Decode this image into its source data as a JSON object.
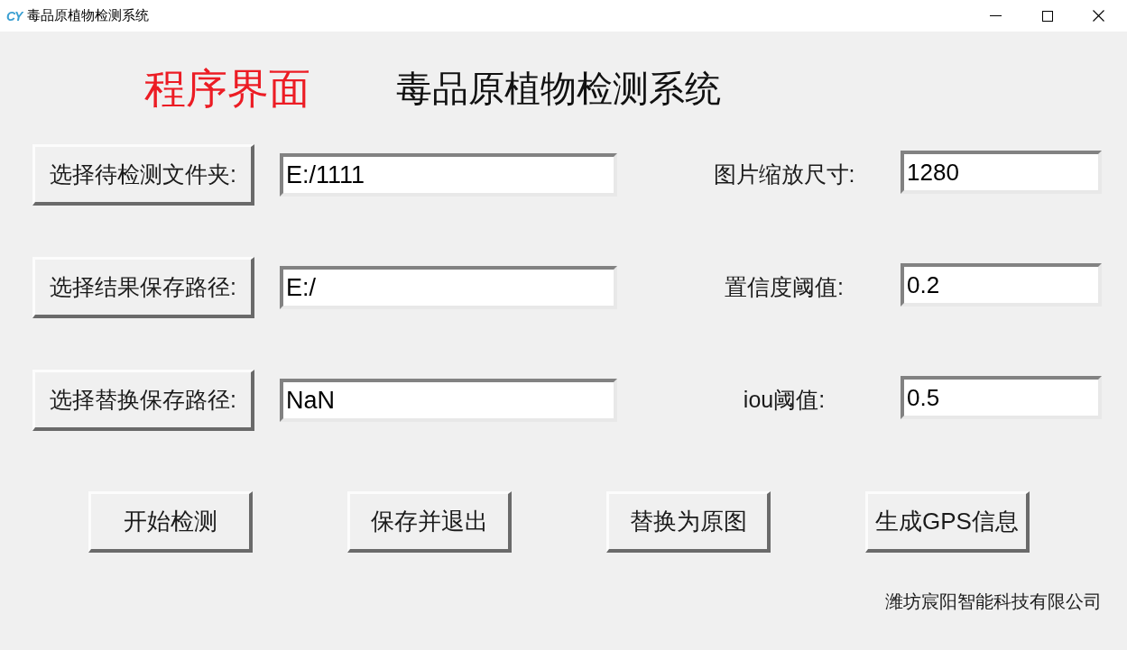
{
  "window": {
    "logo": "CY",
    "title": "毒品原植物检测系统"
  },
  "header": {
    "label": "程序界面",
    "title": "毒品原植物检测系统"
  },
  "rows": [
    {
      "button": "选择待检测文件夹:",
      "path": "E:/1111",
      "setting_label": "图片缩放尺寸:",
      "setting_value": "1280"
    },
    {
      "button": "选择结果保存路径:",
      "path": "E:/",
      "setting_label": "置信度阈值:",
      "setting_value": "0.2"
    },
    {
      "button": "选择替换保存路径:",
      "path": "NaN",
      "setting_label": "iou阈值:",
      "setting_value": "0.5"
    }
  ],
  "actions": [
    "开始检测",
    "保存并退出",
    "替换为原图",
    "生成GPS信息"
  ],
  "footer": "潍坊宸阳智能科技有限公司"
}
